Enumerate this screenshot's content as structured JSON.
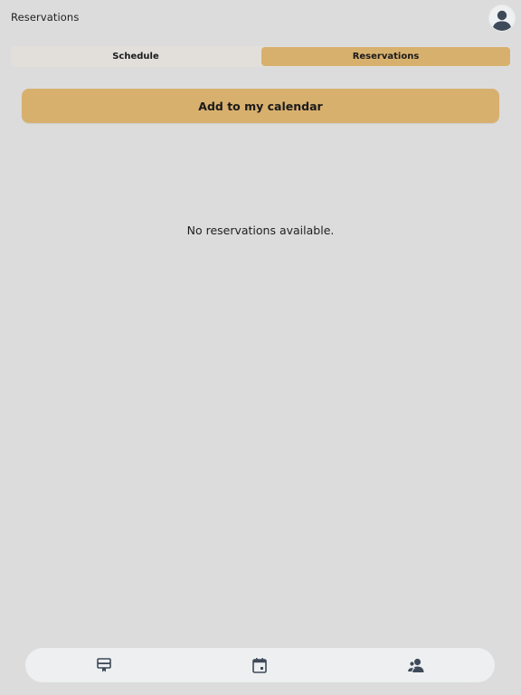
{
  "header": {
    "title": "Reservations",
    "avatar_icon": "user-avatar-icon"
  },
  "segmented": {
    "tabs": [
      {
        "label": "Schedule",
        "selected": false
      },
      {
        "label": "Reservations",
        "selected": true
      }
    ]
  },
  "actions": {
    "add_to_calendar": "Add to my calendar"
  },
  "empty_state": {
    "message": "No reservations available."
  },
  "tab_bar": {
    "items": [
      {
        "icon": "card-ticket-icon"
      },
      {
        "icon": "calendar-icon"
      },
      {
        "icon": "people-icon"
      }
    ]
  },
  "colors": {
    "accent": "#d8b06e",
    "background": "#dcdcdc",
    "tab_bar": "#eeeff1",
    "icon": "#3e4a5a"
  }
}
